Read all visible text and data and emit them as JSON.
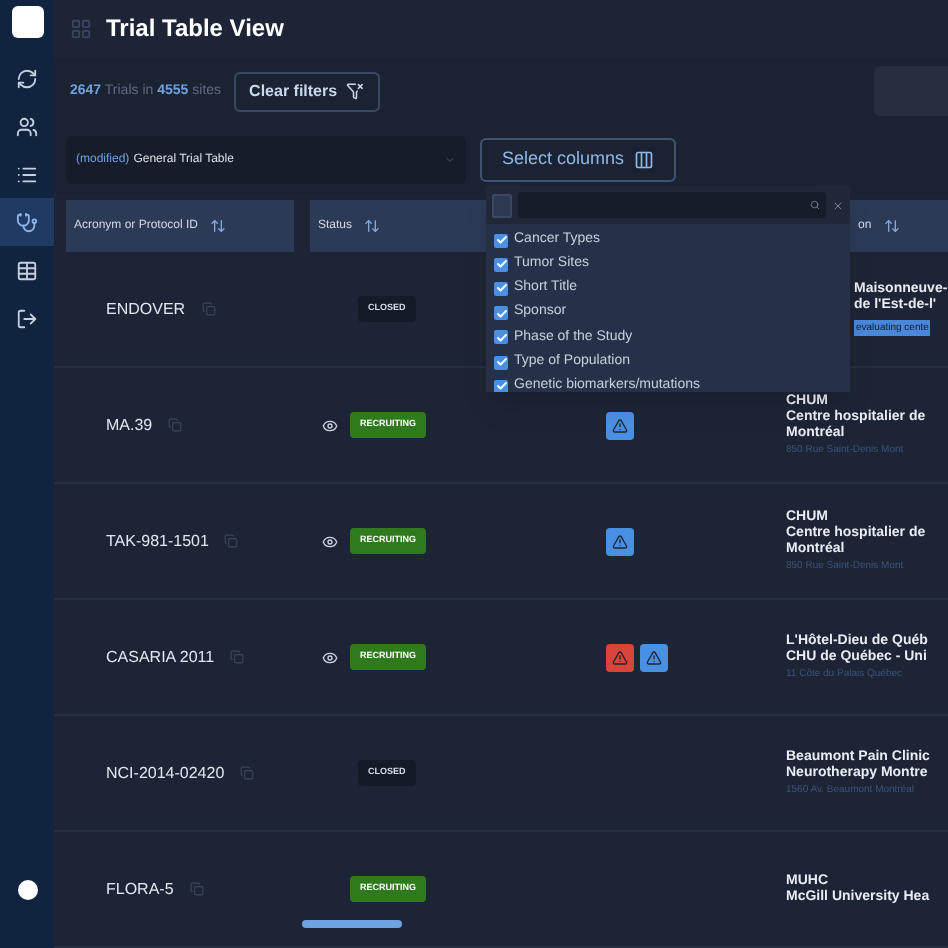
{
  "sidebar": {
    "items": [
      {
        "kind": "refresh",
        "selected": false
      },
      {
        "kind": "people",
        "selected": false
      },
      {
        "kind": "list",
        "selected": false
      },
      {
        "kind": "doctor",
        "selected": true
      },
      {
        "kind": "table",
        "selected": false
      },
      {
        "kind": "exit",
        "selected": false
      }
    ]
  },
  "header": {
    "title": "Trial Table View"
  },
  "summary": {
    "trials": "2647",
    "trials_label": "Trials in",
    "sites": "4555",
    "sites_label": "sites"
  },
  "clear_filters": "Clear filters",
  "view_select": {
    "modifier": "(modified)",
    "value": "General Trial Table"
  },
  "select_columns": "Select columns",
  "columns": [
    {
      "label": "Acronym or Protocol ID"
    },
    {
      "label": "Status"
    },
    {
      "label": "on"
    }
  ],
  "column_menu": {
    "select_all": {
      "checked": false
    },
    "items": [
      {
        "label": "Cancer Types",
        "checked": true
      },
      {
        "label": "Tumor Sites",
        "checked": true
      },
      {
        "label": "Short Title",
        "checked": true
      },
      {
        "label": "Sponsor",
        "checked": true
      },
      {
        "label": "Phase of the Study",
        "checked": true
      },
      {
        "label": "Type of Population",
        "checked": true
      },
      {
        "label": "Genetic biomarkers/mutations",
        "checked": true
      }
    ]
  },
  "rows": [
    {
      "id": "ENDOVER",
      "status": "CLOSED",
      "kind": "closed",
      "eye": false,
      "flags": [],
      "site": [
        "Maisonneuve-",
        "de l'Est-de-l'"
      ],
      "tag": "evaluating cente"
    },
    {
      "id": "MA.39",
      "status": "RECRUITING",
      "kind": "recruiting",
      "eye": true,
      "flags": [
        {
          "color": "#4a90e2"
        }
      ],
      "site": [
        "CHUM",
        "Centre hospitalier de",
        "Montréal"
      ],
      "address": "850 Rue Saint-Denis Mont"
    },
    {
      "id": "TAK-981-1501",
      "status": "RECRUITING",
      "kind": "recruiting",
      "eye": true,
      "flags": [
        {
          "color": "#4a90e2"
        }
      ],
      "site": [
        "CHUM",
        "Centre hospitalier de",
        "Montréal"
      ],
      "address": "850 Rue Saint-Denis Mont"
    },
    {
      "id": "CASARIA 2011",
      "status": "RECRUITING",
      "kind": "recruiting",
      "eye": true,
      "flags": [
        {
          "color": "#d9443a"
        },
        {
          "color": "#4a90e2"
        }
      ],
      "site": [
        "L'Hôtel-Dieu de Québ",
        "CHU de Québec - Uni"
      ],
      "address": "11 Côte du Palais Québec"
    },
    {
      "id": "NCI-2014-02420",
      "status": "CLOSED",
      "kind": "closed",
      "eye": false,
      "flags": [],
      "site": [
        "Beaumont Pain Clinic",
        "Neurotherapy Montre"
      ],
      "address": "1560 Av. Beaumont Montréal"
    },
    {
      "id": "FLORA-5",
      "status": "RECRUITING",
      "kind": "recruiting",
      "eye": false,
      "flags": [],
      "site": [
        "MUHC",
        "McGill University Hea"
      ]
    }
  ]
}
